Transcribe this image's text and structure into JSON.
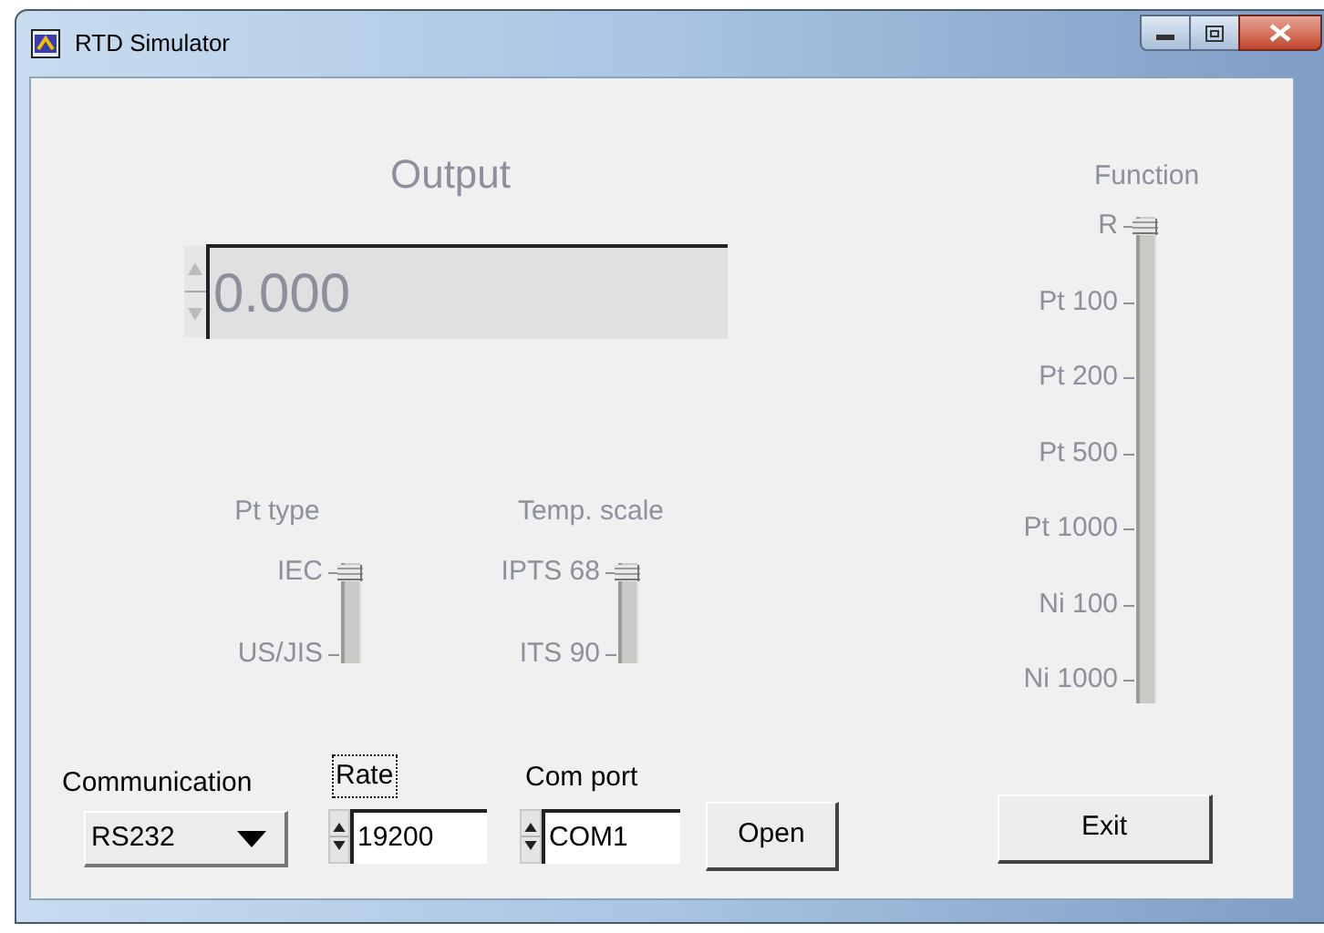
{
  "window": {
    "title": "RTD Simulator"
  },
  "output": {
    "label": "Output",
    "value": "0.000",
    "disabled": true
  },
  "pt_type": {
    "label": "Pt type",
    "disabled": true,
    "options": [
      {
        "label": "IEC",
        "selected": true
      },
      {
        "label": "US/JIS",
        "selected": false
      }
    ]
  },
  "temp_scale": {
    "label": "Temp. scale",
    "disabled": true,
    "options": [
      {
        "label": "IPTS 68",
        "selected": true
      },
      {
        "label": "ITS 90",
        "selected": false
      }
    ]
  },
  "function": {
    "label": "Function",
    "disabled": true,
    "options": [
      {
        "label": "R",
        "selected": true
      },
      {
        "label": "Pt 100",
        "selected": false
      },
      {
        "label": "Pt 200",
        "selected": false
      },
      {
        "label": "Pt 500",
        "selected": false
      },
      {
        "label": "Pt 1000",
        "selected": false
      },
      {
        "label": "Ni 100",
        "selected": false
      },
      {
        "label": "Ni 1000",
        "selected": false
      }
    ]
  },
  "communication": {
    "label": "Communication",
    "value": "RS232"
  },
  "rate": {
    "label": "Rate",
    "value": "19200",
    "focused": true
  },
  "com_port": {
    "label": "Com port",
    "value": "COM1"
  },
  "buttons": [
    {
      "label": "Open",
      "kind": "open"
    },
    {
      "label": "Exit",
      "kind": "exit"
    }
  ]
}
